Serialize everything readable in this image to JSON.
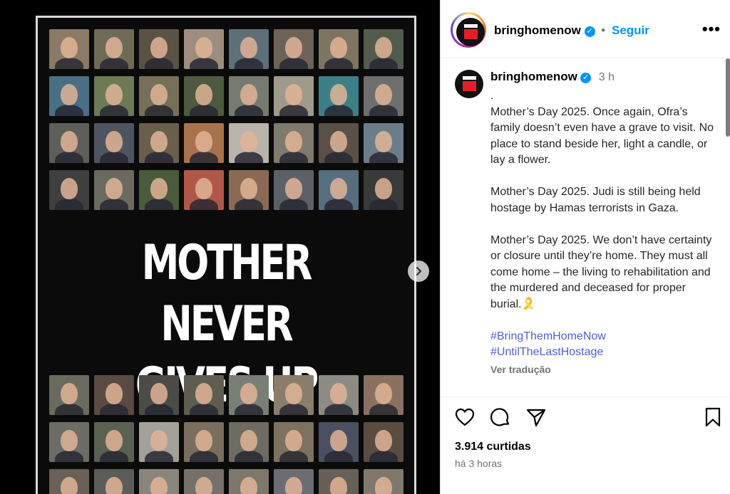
{
  "poster": {
    "headline_line1": "MOTHER NEVER",
    "headline_line2": "GIVES UP",
    "top_face_colors": [
      "#8a7a66",
      "#6f6a57",
      "#5b5246",
      "#9c8d7e",
      "#5e6f78",
      "#6d6258",
      "#7e7462",
      "#525b4c",
      "#4a6f84",
      "#6e7a56",
      "#76705a",
      "#4d5a3f",
      "#777a70",
      "#a09a8c",
      "#3d7f86",
      "#6d6e6e",
      "#5e5f5a",
      "#4f5560",
      "#6a5e4c",
      "#a8734c",
      "#b8b4ac",
      "#7f7a6e",
      "#5a5048",
      "#6b7d8a",
      "#3f3f3f",
      "#6c6a60",
      "#4b5a3a",
      "#b1574a",
      "#8a6a55",
      "#5d6167",
      "#566e7e",
      "#3a3a3a"
    ],
    "bottom_face_colors": [
      "#6b6a5f",
      "#5a4a44",
      "#4d4b48",
      "#5f5d52",
      "#7a7f76",
      "#8a7d6c",
      "#8c8b84",
      "#8a7060",
      "#6d6c66",
      "#5a6152",
      "#a3a09a",
      "#7a6e5f",
      "#6e6b62",
      "#7c725f",
      "#4a5060",
      "#5b4c42",
      "#6a6058",
      "#5c5c58",
      "#8a857c",
      "#75706a",
      "#7d776c",
      "#6b6d72",
      "#666058",
      "#80786c"
    ]
  },
  "header": {
    "username": "bringhomenow",
    "separator": "•",
    "follow_label": "Seguir",
    "more_label": "•••"
  },
  "caption": {
    "username": "bringhomenow",
    "time": "3 h",
    "dot_line": ".",
    "paragraphs": [
      "Mother’s Day 2025. Once again, Ofra’s family doesn’t even have a grave to visit. No place to stand beside her, light a candle, or lay a flower.",
      "Mother’s Day 2025. Judi is still being held hostage by Hamas terrorists in Gaza.",
      "Mother’s Day 2025. We don’t have certainty or closure until they’re home. They must all come home – the living to rehabilitation and the murdered and deceased for proper burial.🎗️"
    ],
    "hashtags": [
      "#BringThemHomeNow",
      "#UntilTheLastHostage"
    ],
    "translate_label": "Ver tradução"
  },
  "stats": {
    "likes": "3.914 curtidas",
    "posted": "há 3 horas"
  },
  "icons": {
    "like": "heart-icon",
    "comment": "comment-icon",
    "share": "share-icon",
    "save": "bookmark-icon",
    "next": "chevron-right-icon"
  },
  "colors": {
    "accent": "#0095f6",
    "hashtag": "#4d5fd6",
    "badge_red": "#e3202a"
  }
}
